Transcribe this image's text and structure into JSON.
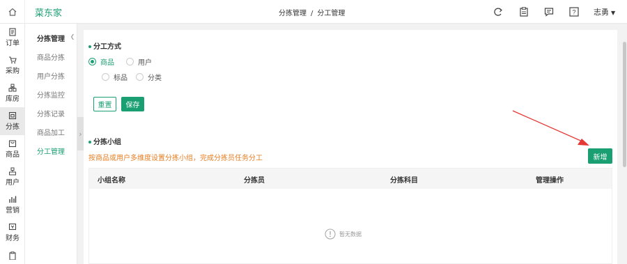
{
  "header": {
    "brand": "菜东家",
    "breadcrumb": [
      "分拣管理",
      "分工管理"
    ],
    "breadcrumb_sep": "/",
    "user_name": "志勇",
    "user_caret": "▼",
    "icons": [
      "refresh-icon",
      "clipboard-icon",
      "message-icon",
      "help-icon"
    ]
  },
  "leftnav": {
    "items": [
      {
        "label": "订单",
        "icon": "order-icon"
      },
      {
        "label": "采购",
        "icon": "cart-icon"
      },
      {
        "label": "库房",
        "icon": "warehouse-icon"
      },
      {
        "label": "分拣",
        "icon": "sort-icon",
        "active": true
      },
      {
        "label": "商品",
        "icon": "product-icon"
      },
      {
        "label": "用户",
        "icon": "user-icon"
      },
      {
        "label": "营销",
        "icon": "marketing-icon"
      },
      {
        "label": "财务",
        "icon": "finance-icon"
      }
    ]
  },
  "subnav": {
    "title": "分拣管理",
    "items": [
      "商品分拣",
      "用户分拣",
      "分拣监控",
      "分拣记录",
      "商品加工",
      "分工管理"
    ],
    "active_index": 5
  },
  "division": {
    "title": "分工方式",
    "options_row1": [
      {
        "label": "商品",
        "checked": true
      },
      {
        "label": "用户",
        "checked": false
      }
    ],
    "options_row2": [
      {
        "label": "标品",
        "checked": false
      },
      {
        "label": "分类",
        "checked": false
      }
    ],
    "reset_label": "重置",
    "save_label": "保存"
  },
  "groups": {
    "title": "分拣小组",
    "hint": "按商品或用户多维度设置分拣小组，完成分拣员任务分工",
    "add_label": "新增",
    "columns": [
      "小组名称",
      "分拣员",
      "分拣科目",
      "管理操作"
    ],
    "empty_text": "暂无数据"
  },
  "colors": {
    "accent": "#1a9f72",
    "hint": "#e67e22",
    "arrow": "#e53935"
  }
}
